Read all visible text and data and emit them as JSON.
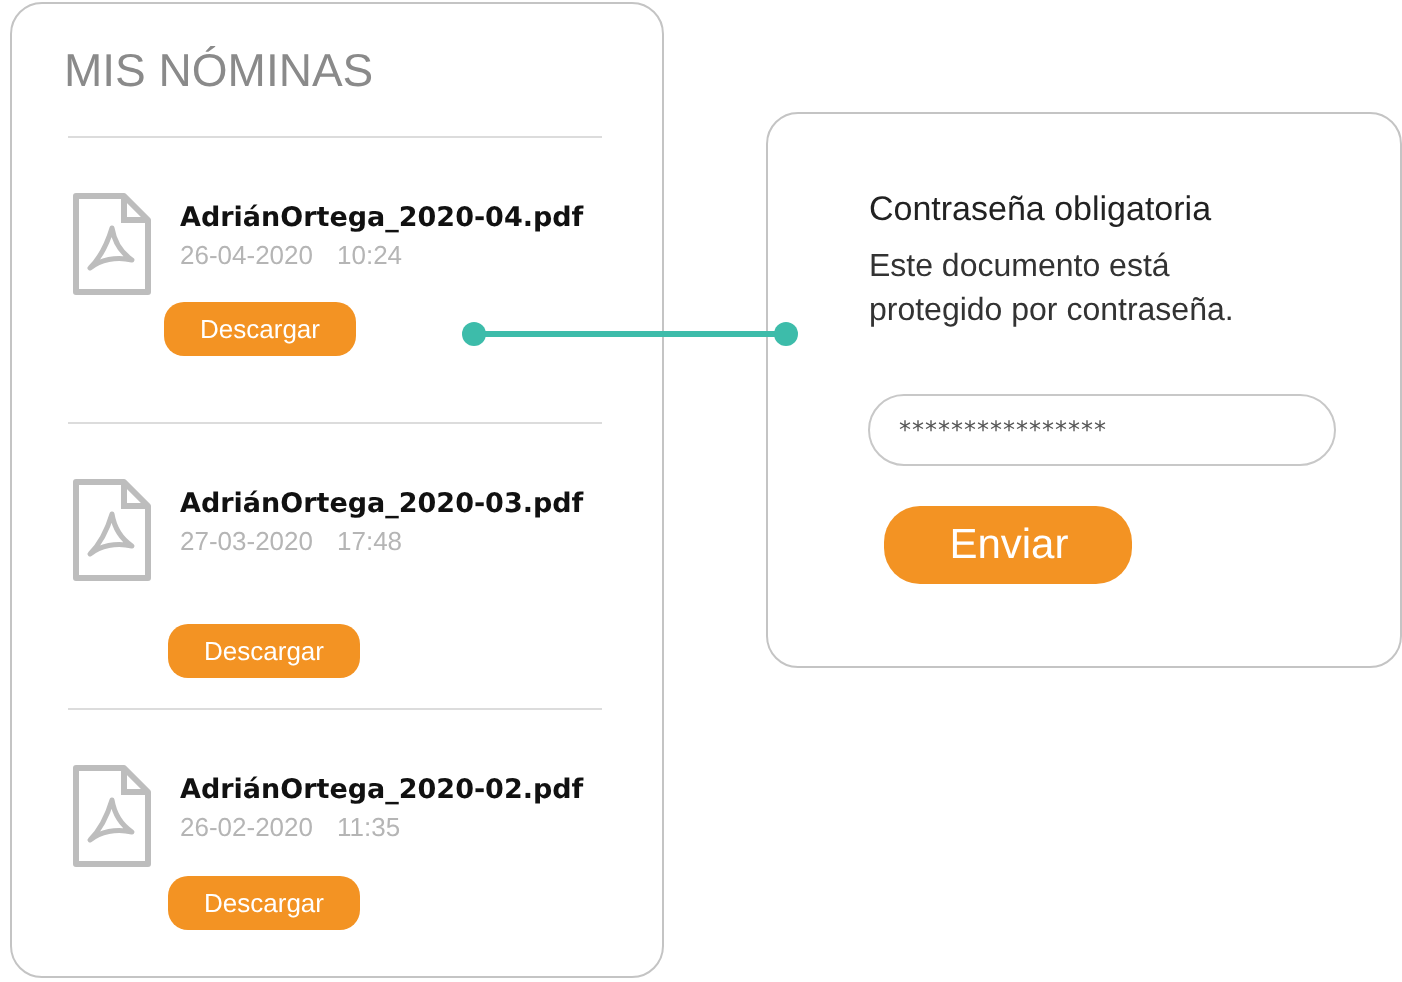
{
  "files_card": {
    "title": "MIS NÓMINAS",
    "files": [
      {
        "name": "AdriánOrtega_2020-04.pdf",
        "date": "26-04-2020",
        "time": "10:24",
        "button": "Descargar"
      },
      {
        "name": "AdriánOrtega_2020-03.pdf",
        "date": "27-03-2020",
        "time": "17:48",
        "button": "Descargar"
      },
      {
        "name": "AdriánOrtega_2020-02.pdf",
        "date": "26-02-2020",
        "time": "11:35",
        "button": "Descargar"
      }
    ]
  },
  "password_dialog": {
    "title": "Contraseña obligatoria",
    "message": "Este documento está protegido por contraseña.",
    "password": "****************",
    "button": "Enviar"
  }
}
